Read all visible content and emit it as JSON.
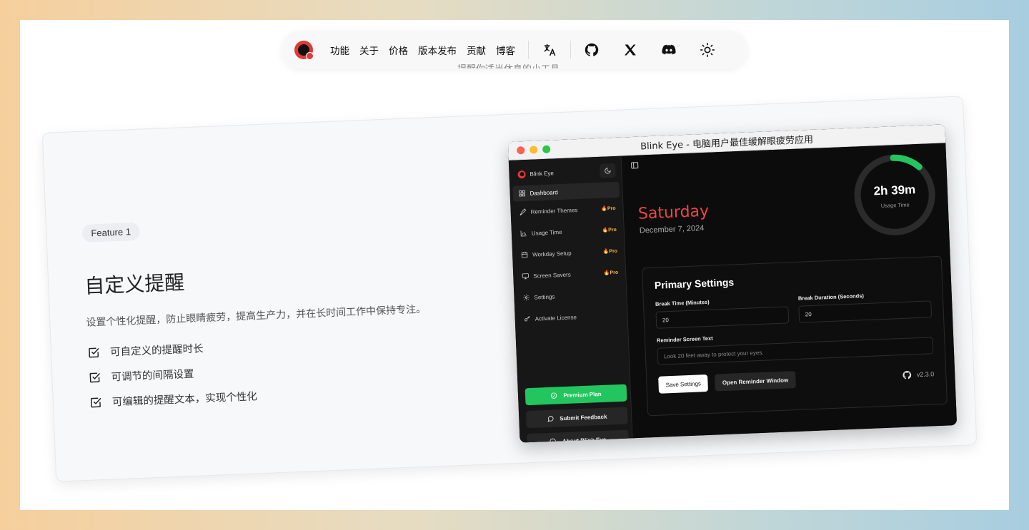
{
  "nav": {
    "items": [
      "功能",
      "关于",
      "价格",
      "版本发布",
      "贡献",
      "博客"
    ],
    "icons": [
      "translate-icon",
      "github-icon",
      "x-icon",
      "discord-icon",
      "sun-icon"
    ],
    "obscured_subtitle": "提醒你适当休息的小工具。"
  },
  "feature": {
    "badge": "Feature 1",
    "title": "自定义提醒",
    "description": "设置个性化提醒，防止眼睛疲劳，提高生产力，并在长时间工作中保持专注。",
    "bullets": [
      "可自定义的提醒时长",
      "可调节的间隔设置",
      "可编辑的提醒文本，实现个性化"
    ]
  },
  "app": {
    "window_title": "Blink Eye - 电脑用户最佳缓解眼疲劳应用",
    "brand": "Blink Eye",
    "sidebar": {
      "items": [
        {
          "label": "Dashboard",
          "icon": "grid-icon",
          "pro": false,
          "active": true
        },
        {
          "label": "Reminder Themes",
          "icon": "brush-icon",
          "pro": true
        },
        {
          "label": "Usage Time",
          "icon": "bar-chart-icon",
          "pro": true
        },
        {
          "label": "Workday Setup",
          "icon": "calendar-icon",
          "pro": true
        },
        {
          "label": "Screen Savers",
          "icon": "monitor-icon",
          "pro": true
        },
        {
          "label": "Settings",
          "icon": "gear-icon",
          "pro": false
        },
        {
          "label": "Activate License",
          "icon": "key-icon",
          "pro": false
        }
      ],
      "pro_label": "Pro",
      "premium_label": "Premium Plan",
      "feedback_label": "Submit Feedback",
      "about_label": "About Blink Eye"
    },
    "main": {
      "day": "Saturday",
      "date": "December 7, 2024",
      "usage_value": "2h 39m",
      "usage_label": "Usage Time",
      "usage_progress": 0.12,
      "settings_title": "Primary Settings",
      "break_time_label": "Break Time (Minutes)",
      "break_time_value": "20",
      "break_duration_label": "Break Duration (Seconds)",
      "break_duration_value": "20",
      "reminder_text_label": "Reminder Screen Text",
      "reminder_text_placeholder": "Look 20 feet away to protect your eyes.",
      "save_label": "Save Settings",
      "open_label": "Open Reminder Window",
      "version": "v2.3.0"
    }
  },
  "colors": {
    "accent_red": "#ef4444",
    "accent_green": "#22c55e",
    "pro_gold": "#f6b93b"
  }
}
